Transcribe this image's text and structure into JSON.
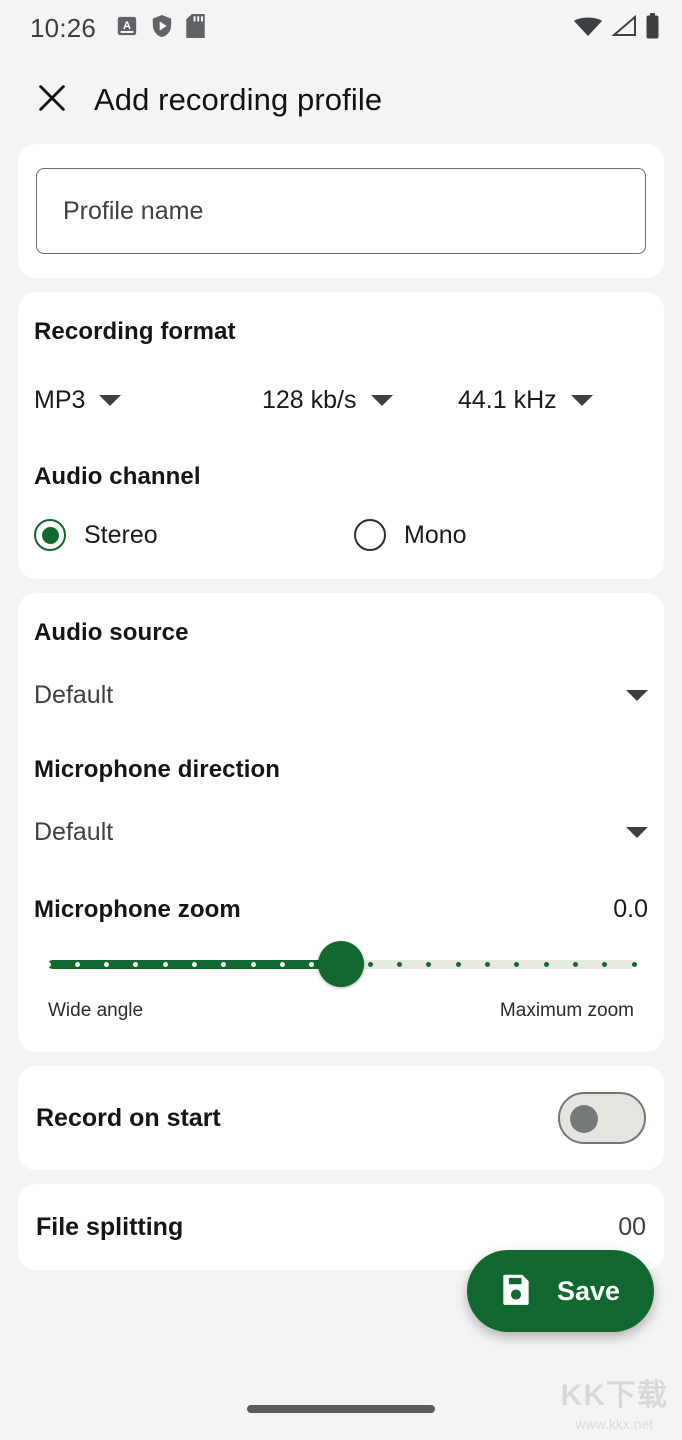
{
  "status_bar": {
    "clock": "10:26",
    "left_icons": [
      "a-badge-icon",
      "play-shield-icon",
      "sd-card-icon"
    ],
    "right_icons": [
      "wifi-icon",
      "cell-signal-icon",
      "battery-icon"
    ]
  },
  "app_bar": {
    "close_icon": "close-icon",
    "title": "Add recording profile"
  },
  "profile_name": {
    "value": "",
    "placeholder": "Profile name"
  },
  "recording_format": {
    "title": "Recording format",
    "format": "MP3",
    "bitrate": "128 kb/s",
    "sample_rate": "44.1 kHz"
  },
  "audio_channel": {
    "title": "Audio channel",
    "options": [
      {
        "label": "Stereo",
        "selected": true
      },
      {
        "label": "Mono",
        "selected": false
      }
    ]
  },
  "audio_source": {
    "title": "Audio source",
    "value": "Default"
  },
  "microphone_direction": {
    "title": "Microphone direction",
    "value": "Default"
  },
  "microphone_zoom": {
    "title": "Microphone zoom",
    "value": "0.0",
    "min_label": "Wide angle",
    "max_label": "Maximum zoom",
    "position_percent": 50,
    "tick_count": 21
  },
  "record_on_start": {
    "label": "Record on start",
    "enabled": false
  },
  "file_splitting": {
    "label": "File splitting",
    "value": "00"
  },
  "save_fab": {
    "label": "Save",
    "icon": "save-floppy-icon"
  },
  "watermark": {
    "logo": "KK下载",
    "url": "www.kkx.net"
  },
  "colors": {
    "accent_green": "#10682e",
    "page_background": "#f4f4f4",
    "card_background": "#ffffff"
  }
}
